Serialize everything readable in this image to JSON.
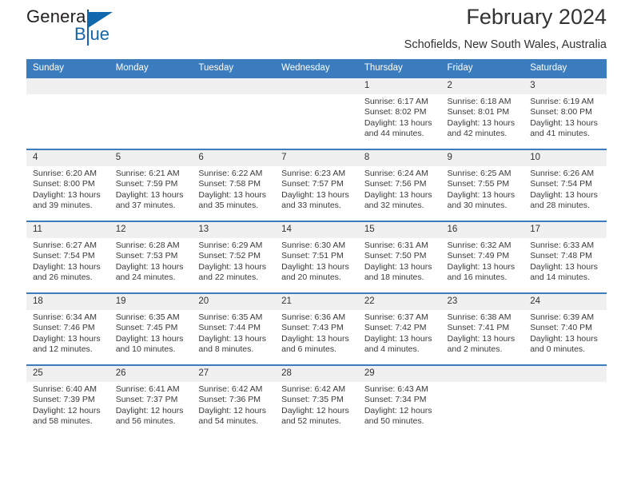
{
  "brand": {
    "name_top": "General",
    "name_bottom": "Blue",
    "flag_icon": "triangle-flag-icon"
  },
  "header": {
    "title": "February 2024",
    "subtitle": "Schofields, New South Wales, Australia"
  },
  "colors": {
    "header_blue": "#3a7cbe",
    "brand_blue": "#1268ad",
    "daynum_band": "#f0f0f0",
    "text": "#333333"
  },
  "calendar": {
    "weekday_headers": [
      "Sunday",
      "Monday",
      "Tuesday",
      "Wednesday",
      "Thursday",
      "Friday",
      "Saturday"
    ],
    "weeks": [
      [
        {
          "day": "",
          "empty": true,
          "sunrise": "",
          "sunset": "",
          "daylight1": "",
          "daylight2": ""
        },
        {
          "day": "",
          "empty": true,
          "sunrise": "",
          "sunset": "",
          "daylight1": "",
          "daylight2": ""
        },
        {
          "day": "",
          "empty": true,
          "sunrise": "",
          "sunset": "",
          "daylight1": "",
          "daylight2": ""
        },
        {
          "day": "",
          "empty": true,
          "sunrise": "",
          "sunset": "",
          "daylight1": "",
          "daylight2": ""
        },
        {
          "day": "1",
          "sunrise": "Sunrise: 6:17 AM",
          "sunset": "Sunset: 8:02 PM",
          "daylight1": "Daylight: 13 hours",
          "daylight2": "and 44 minutes."
        },
        {
          "day": "2",
          "sunrise": "Sunrise: 6:18 AM",
          "sunset": "Sunset: 8:01 PM",
          "daylight1": "Daylight: 13 hours",
          "daylight2": "and 42 minutes."
        },
        {
          "day": "3",
          "sunrise": "Sunrise: 6:19 AM",
          "sunset": "Sunset: 8:00 PM",
          "daylight1": "Daylight: 13 hours",
          "daylight2": "and 41 minutes."
        }
      ],
      [
        {
          "day": "4",
          "sunrise": "Sunrise: 6:20 AM",
          "sunset": "Sunset: 8:00 PM",
          "daylight1": "Daylight: 13 hours",
          "daylight2": "and 39 minutes."
        },
        {
          "day": "5",
          "sunrise": "Sunrise: 6:21 AM",
          "sunset": "Sunset: 7:59 PM",
          "daylight1": "Daylight: 13 hours",
          "daylight2": "and 37 minutes."
        },
        {
          "day": "6",
          "sunrise": "Sunrise: 6:22 AM",
          "sunset": "Sunset: 7:58 PM",
          "daylight1": "Daylight: 13 hours",
          "daylight2": "and 35 minutes."
        },
        {
          "day": "7",
          "sunrise": "Sunrise: 6:23 AM",
          "sunset": "Sunset: 7:57 PM",
          "daylight1": "Daylight: 13 hours",
          "daylight2": "and 33 minutes."
        },
        {
          "day": "8",
          "sunrise": "Sunrise: 6:24 AM",
          "sunset": "Sunset: 7:56 PM",
          "daylight1": "Daylight: 13 hours",
          "daylight2": "and 32 minutes."
        },
        {
          "day": "9",
          "sunrise": "Sunrise: 6:25 AM",
          "sunset": "Sunset: 7:55 PM",
          "daylight1": "Daylight: 13 hours",
          "daylight2": "and 30 minutes."
        },
        {
          "day": "10",
          "sunrise": "Sunrise: 6:26 AM",
          "sunset": "Sunset: 7:54 PM",
          "daylight1": "Daylight: 13 hours",
          "daylight2": "and 28 minutes."
        }
      ],
      [
        {
          "day": "11",
          "sunrise": "Sunrise: 6:27 AM",
          "sunset": "Sunset: 7:54 PM",
          "daylight1": "Daylight: 13 hours",
          "daylight2": "and 26 minutes."
        },
        {
          "day": "12",
          "sunrise": "Sunrise: 6:28 AM",
          "sunset": "Sunset: 7:53 PM",
          "daylight1": "Daylight: 13 hours",
          "daylight2": "and 24 minutes."
        },
        {
          "day": "13",
          "sunrise": "Sunrise: 6:29 AM",
          "sunset": "Sunset: 7:52 PM",
          "daylight1": "Daylight: 13 hours",
          "daylight2": "and 22 minutes."
        },
        {
          "day": "14",
          "sunrise": "Sunrise: 6:30 AM",
          "sunset": "Sunset: 7:51 PM",
          "daylight1": "Daylight: 13 hours",
          "daylight2": "and 20 minutes."
        },
        {
          "day": "15",
          "sunrise": "Sunrise: 6:31 AM",
          "sunset": "Sunset: 7:50 PM",
          "daylight1": "Daylight: 13 hours",
          "daylight2": "and 18 minutes."
        },
        {
          "day": "16",
          "sunrise": "Sunrise: 6:32 AM",
          "sunset": "Sunset: 7:49 PM",
          "daylight1": "Daylight: 13 hours",
          "daylight2": "and 16 minutes."
        },
        {
          "day": "17",
          "sunrise": "Sunrise: 6:33 AM",
          "sunset": "Sunset: 7:48 PM",
          "daylight1": "Daylight: 13 hours",
          "daylight2": "and 14 minutes."
        }
      ],
      [
        {
          "day": "18",
          "sunrise": "Sunrise: 6:34 AM",
          "sunset": "Sunset: 7:46 PM",
          "daylight1": "Daylight: 13 hours",
          "daylight2": "and 12 minutes."
        },
        {
          "day": "19",
          "sunrise": "Sunrise: 6:35 AM",
          "sunset": "Sunset: 7:45 PM",
          "daylight1": "Daylight: 13 hours",
          "daylight2": "and 10 minutes."
        },
        {
          "day": "20",
          "sunrise": "Sunrise: 6:35 AM",
          "sunset": "Sunset: 7:44 PM",
          "daylight1": "Daylight: 13 hours",
          "daylight2": "and 8 minutes."
        },
        {
          "day": "21",
          "sunrise": "Sunrise: 6:36 AM",
          "sunset": "Sunset: 7:43 PM",
          "daylight1": "Daylight: 13 hours",
          "daylight2": "and 6 minutes."
        },
        {
          "day": "22",
          "sunrise": "Sunrise: 6:37 AM",
          "sunset": "Sunset: 7:42 PM",
          "daylight1": "Daylight: 13 hours",
          "daylight2": "and 4 minutes."
        },
        {
          "day": "23",
          "sunrise": "Sunrise: 6:38 AM",
          "sunset": "Sunset: 7:41 PM",
          "daylight1": "Daylight: 13 hours",
          "daylight2": "and 2 minutes."
        },
        {
          "day": "24",
          "sunrise": "Sunrise: 6:39 AM",
          "sunset": "Sunset: 7:40 PM",
          "daylight1": "Daylight: 13 hours",
          "daylight2": "and 0 minutes."
        }
      ],
      [
        {
          "day": "25",
          "sunrise": "Sunrise: 6:40 AM",
          "sunset": "Sunset: 7:39 PM",
          "daylight1": "Daylight: 12 hours",
          "daylight2": "and 58 minutes."
        },
        {
          "day": "26",
          "sunrise": "Sunrise: 6:41 AM",
          "sunset": "Sunset: 7:37 PM",
          "daylight1": "Daylight: 12 hours",
          "daylight2": "and 56 minutes."
        },
        {
          "day": "27",
          "sunrise": "Sunrise: 6:42 AM",
          "sunset": "Sunset: 7:36 PM",
          "daylight1": "Daylight: 12 hours",
          "daylight2": "and 54 minutes."
        },
        {
          "day": "28",
          "sunrise": "Sunrise: 6:42 AM",
          "sunset": "Sunset: 7:35 PM",
          "daylight1": "Daylight: 12 hours",
          "daylight2": "and 52 minutes."
        },
        {
          "day": "29",
          "sunrise": "Sunrise: 6:43 AM",
          "sunset": "Sunset: 7:34 PM",
          "daylight1": "Daylight: 12 hours",
          "daylight2": "and 50 minutes."
        },
        {
          "day": "",
          "empty": true,
          "sunrise": "",
          "sunset": "",
          "daylight1": "",
          "daylight2": ""
        },
        {
          "day": "",
          "empty": true,
          "sunrise": "",
          "sunset": "",
          "daylight1": "",
          "daylight2": ""
        }
      ]
    ]
  }
}
